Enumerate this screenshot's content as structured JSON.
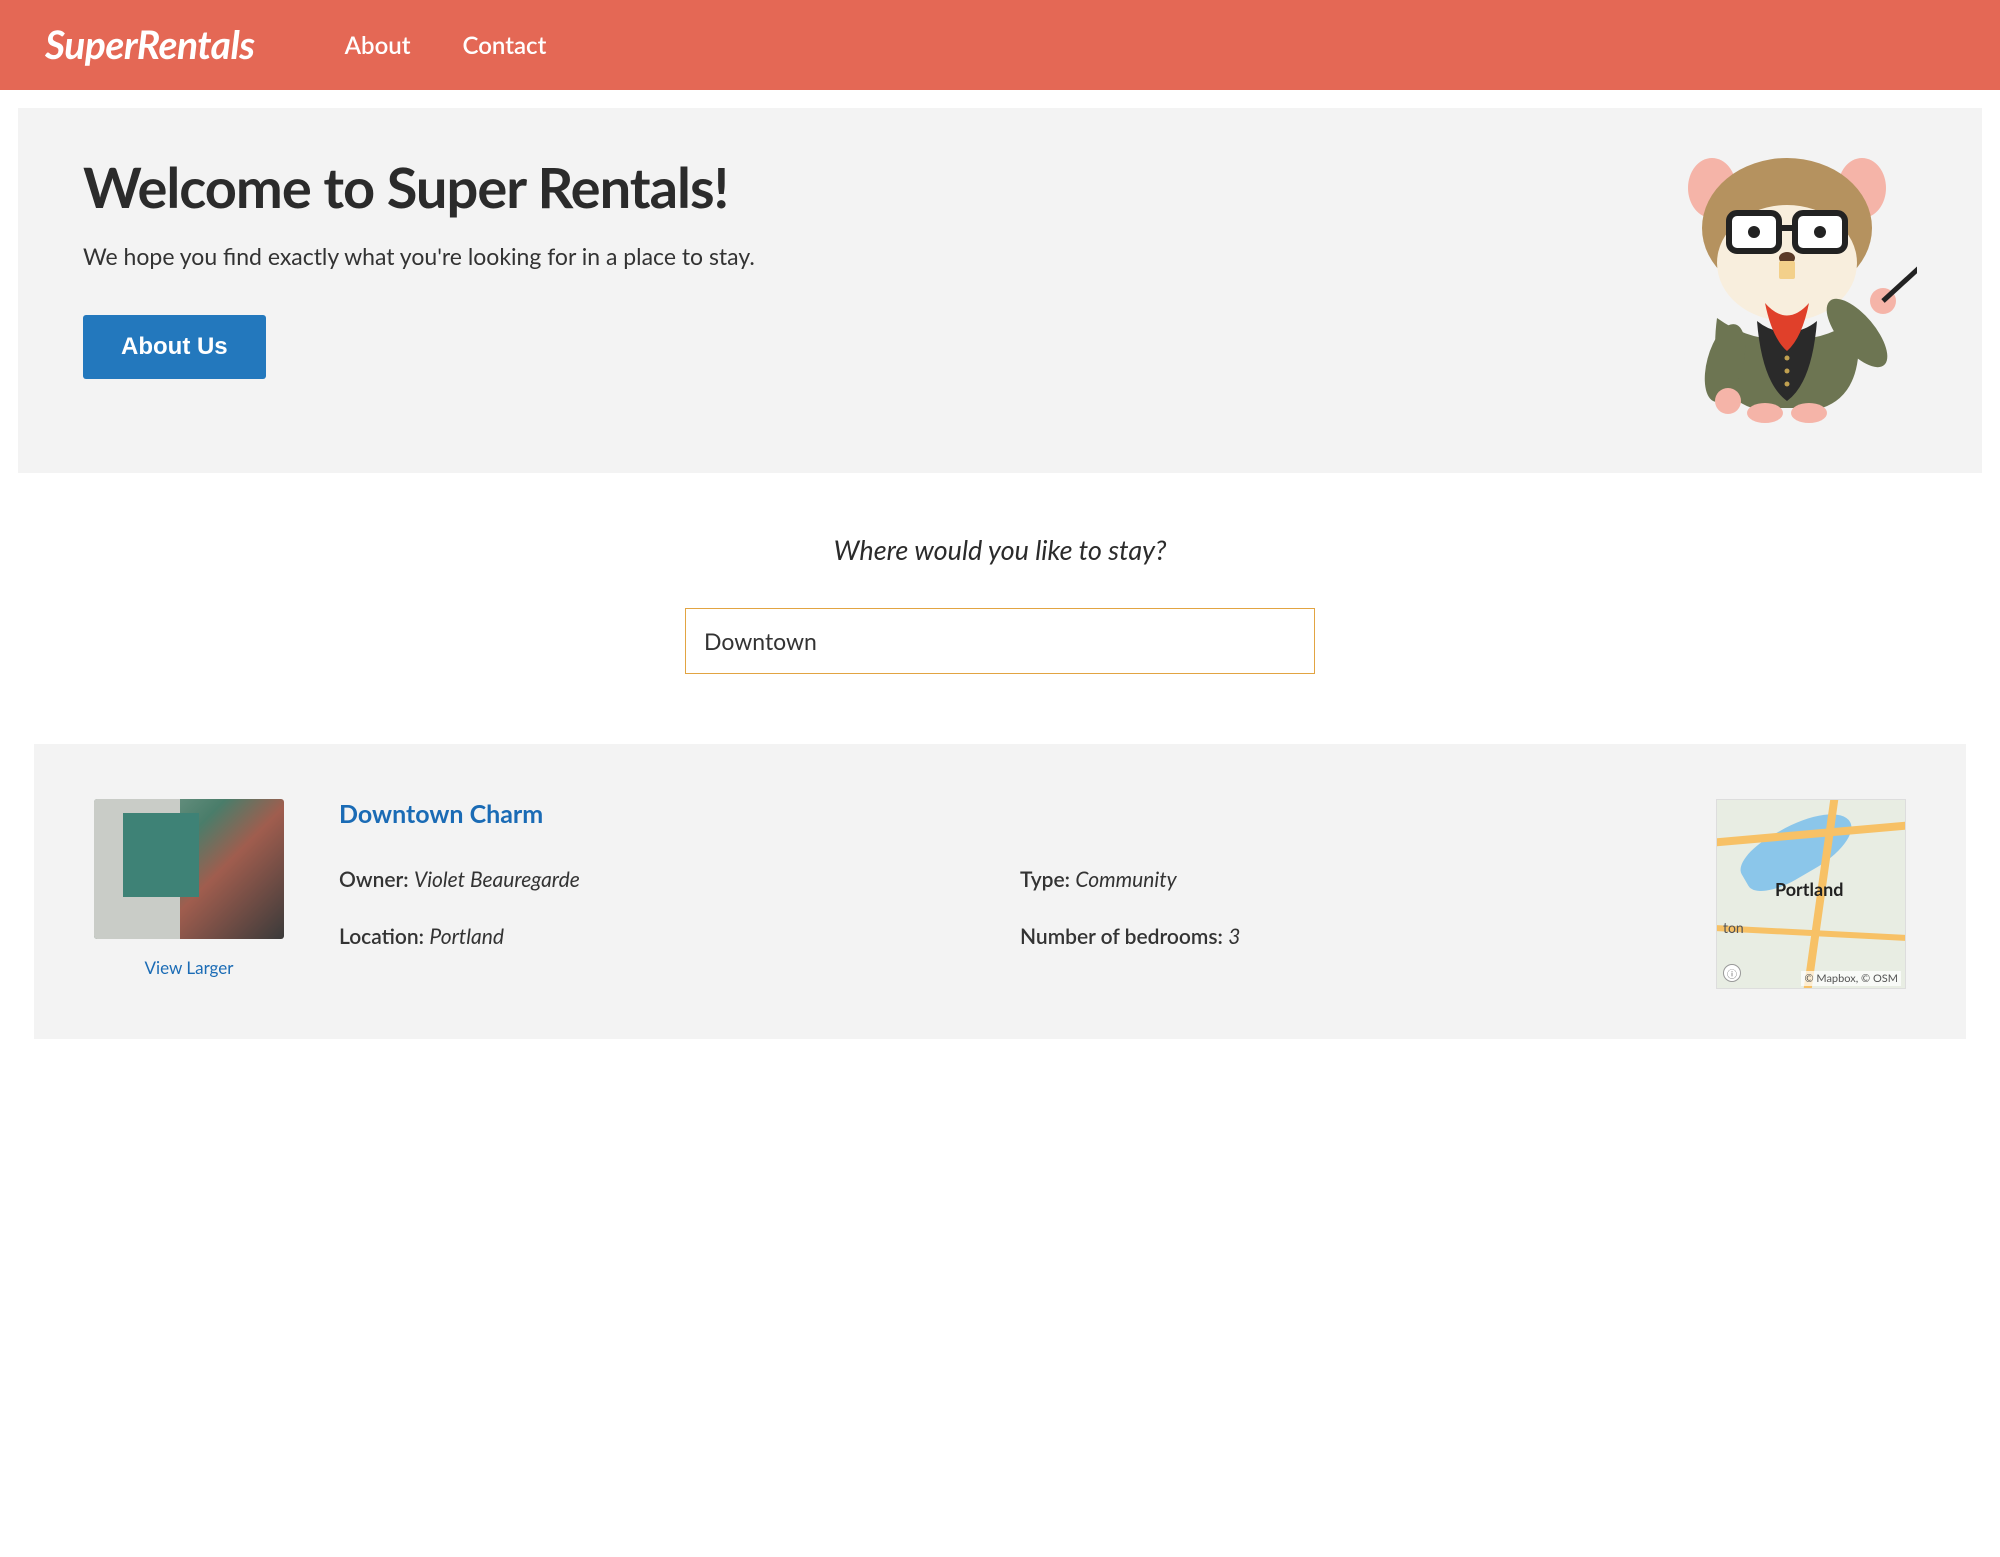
{
  "nav": {
    "logo": "SuperRentals",
    "links": [
      "About",
      "Contact"
    ]
  },
  "jumbo": {
    "title": "Welcome to Super Rentals!",
    "subtitle": "We hope you find exactly what you're looking for in a place to stay.",
    "button": "About Us"
  },
  "search": {
    "label": "Where would you like to stay?",
    "value": "Downtown"
  },
  "rental": {
    "title": "Downtown Charm",
    "viewLarger": "View Larger",
    "owner": {
      "label": "Owner:",
      "value": "Violet Beauregarde"
    },
    "type": {
      "label": "Type:",
      "value": "Community"
    },
    "location": {
      "label": "Location:",
      "value": "Portland"
    },
    "bedrooms": {
      "label": "Number of bedrooms:",
      "value": "3"
    },
    "map": {
      "city": "Portland",
      "sublabel": "ton",
      "attribution": "© Mapbox, © OSM"
    }
  }
}
